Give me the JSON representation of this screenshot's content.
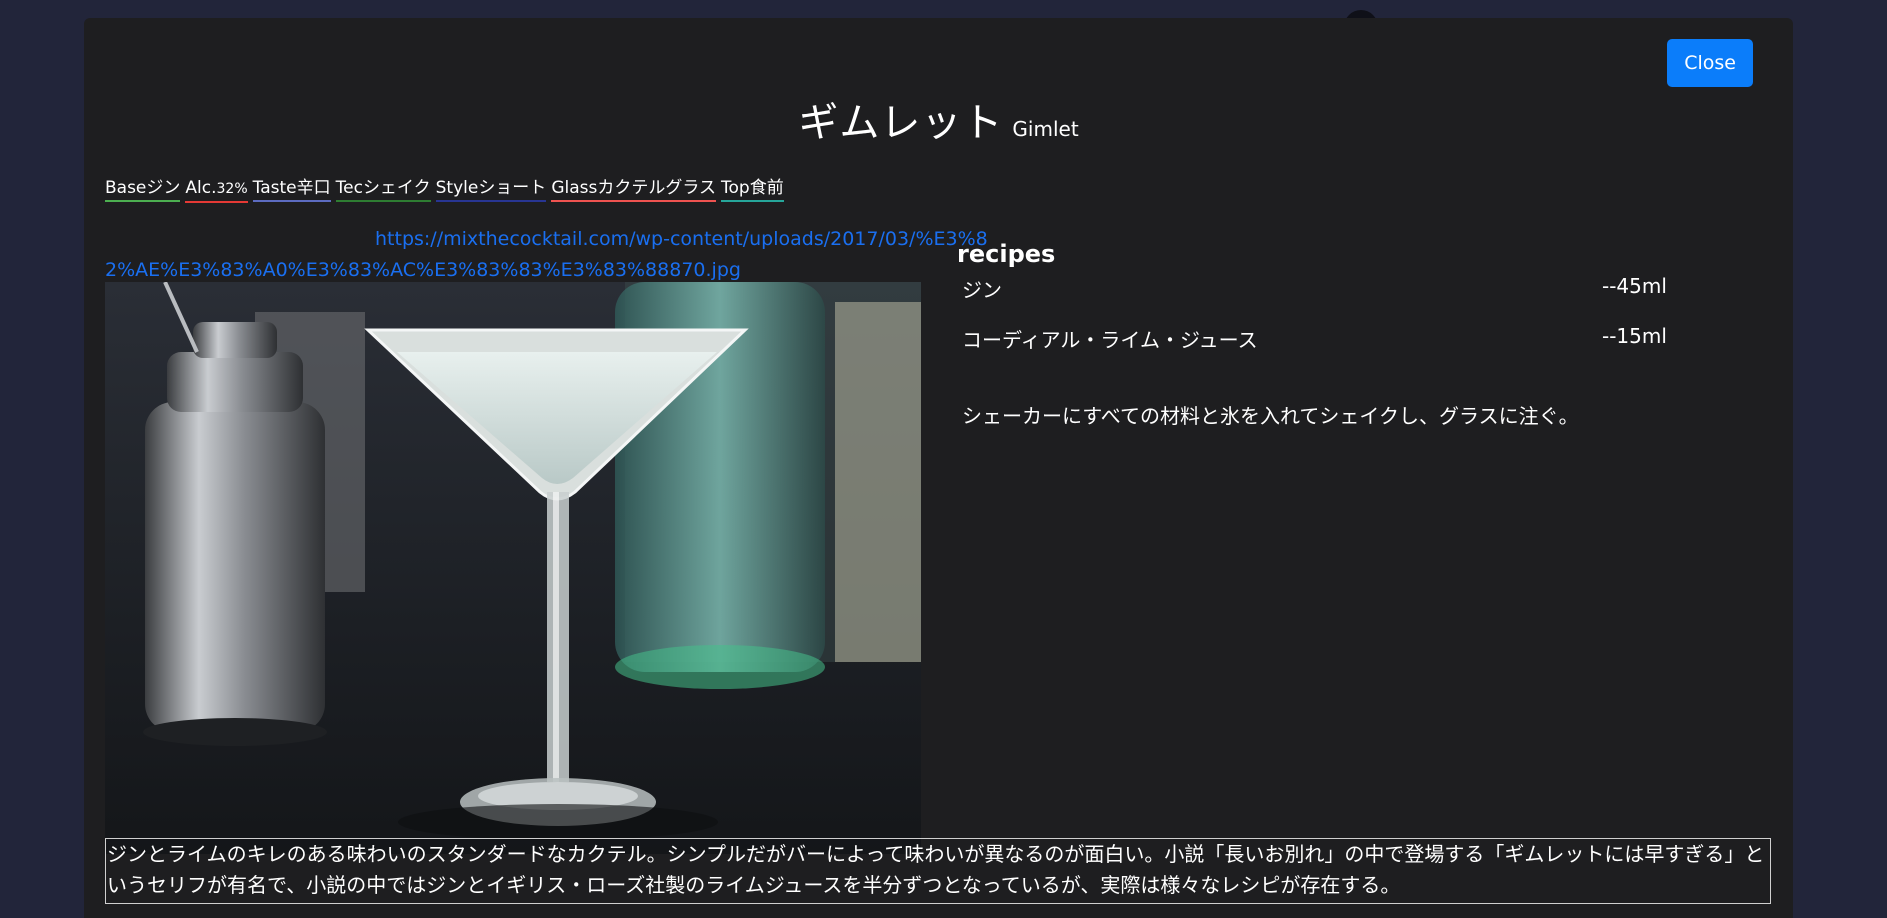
{
  "modal": {
    "close_label": "Close",
    "title_ja": "ギムレット",
    "title_en": "Gimlet",
    "tags": [
      {
        "label": "Base",
        "value": "ジン",
        "color": "#4caf50"
      },
      {
        "label": "Alc.",
        "value": "32%",
        "color": "#e53935"
      },
      {
        "label": "Taste",
        "value": "辛口",
        "color": "#5c6bc0"
      },
      {
        "label": "Tec",
        "value": "シェイク",
        "color": "#2e7d32"
      },
      {
        "label": "Style",
        "value": "ショート",
        "color": "#283593"
      },
      {
        "label": "Glass",
        "value": "カクテルグラス",
        "color": "#ef5350"
      },
      {
        "label": "Top",
        "value": "食前",
        "color": "#26a69a"
      }
    ],
    "image_url": "https://mixthecocktail.com/wp-content/uploads/2017/03/%E3%82%AE%E3%83%A0%E3%83%AC%E3%83%83%E3%83%88870.jpg",
    "recipes_title": "recipes",
    "ingredients": [
      {
        "name": "ジン",
        "amount": "--45ml"
      },
      {
        "name": "コーディアル・ライム・ジュース",
        "amount": "--15ml"
      }
    ],
    "method": "シェーカーにすべての材料と氷を入れてシェイクし、グラスに注ぐ。",
    "description": "ジンとライムのキレのある味わいのスタンダードなカクテル。シンプルだがバーによって味わいが異なるのが面白い。小説「長いお別れ」の中で登場する「ギムレットには早すぎる」というセリフが有名で、小説の中ではジンとイギリス・ローズ社製のライムジュースを半分ずつとなっているが、実際は様々なレシピが存在する。"
  }
}
